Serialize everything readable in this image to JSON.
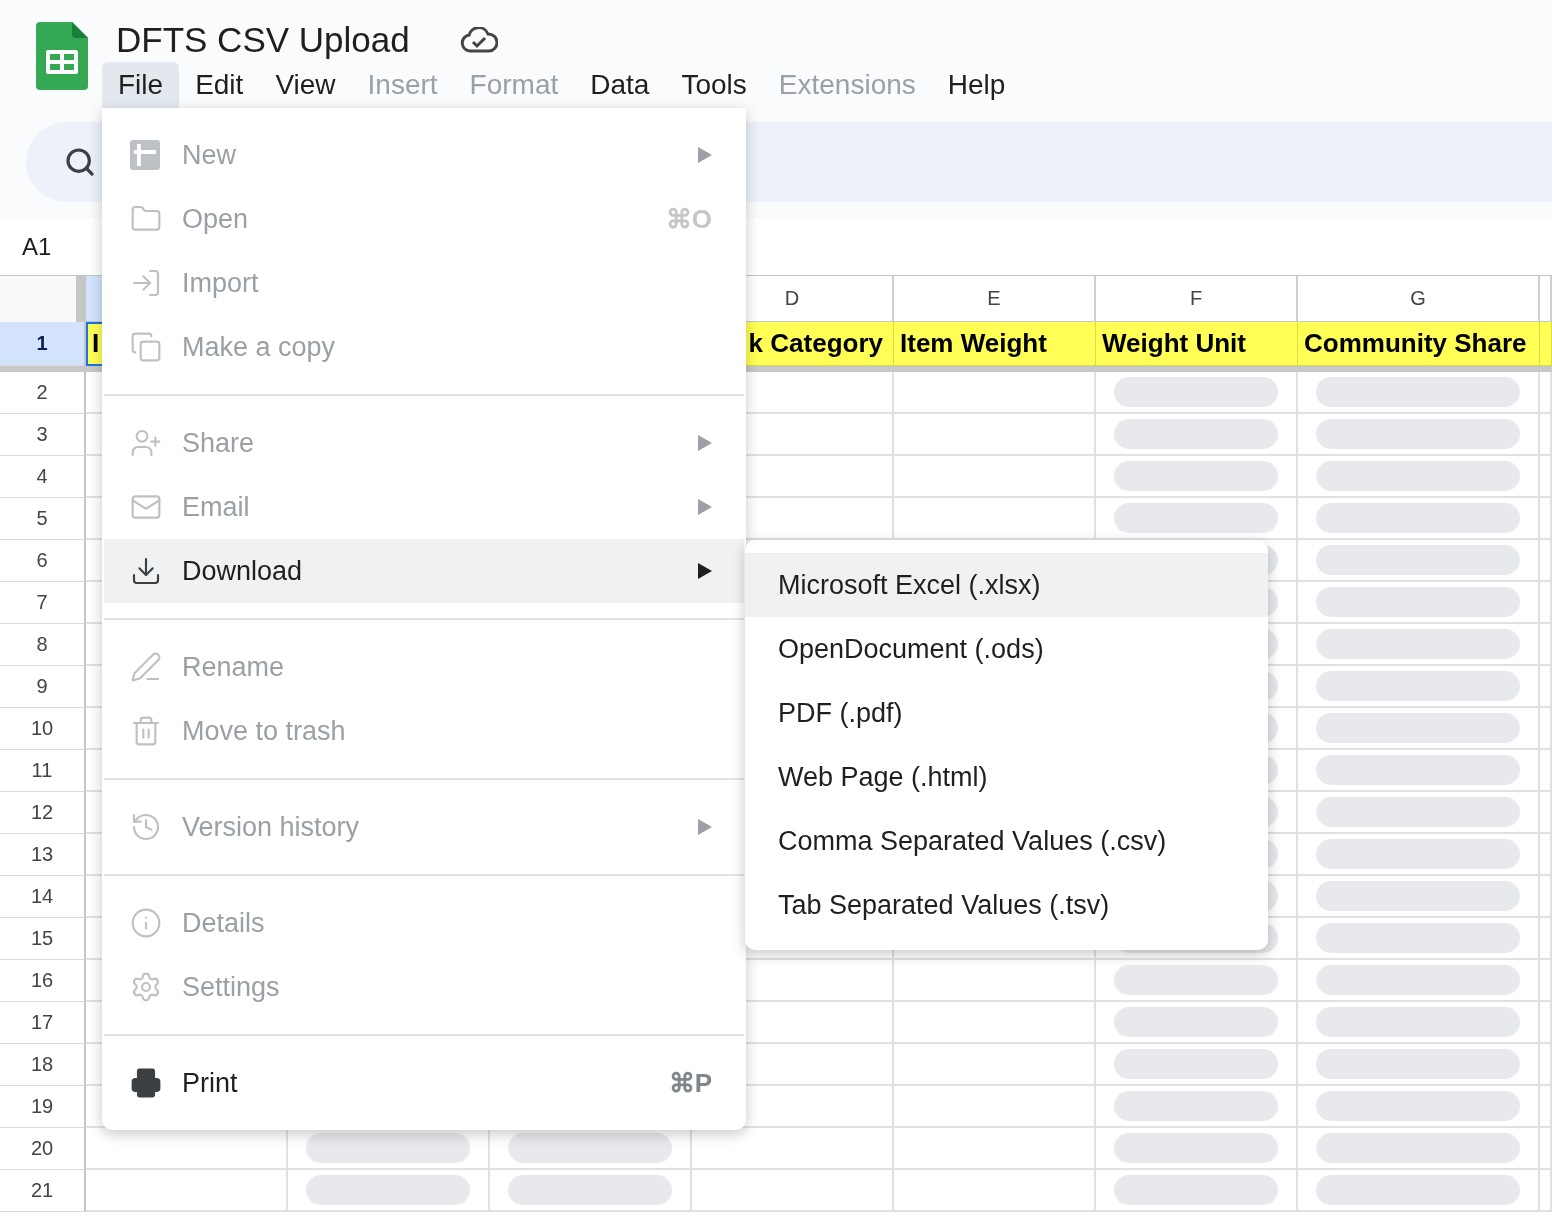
{
  "app": {
    "title": "DFTS CSV Upload"
  },
  "menubar": [
    {
      "label": "File",
      "selected": true,
      "disabled": false
    },
    {
      "label": "Edit",
      "selected": false,
      "disabled": false
    },
    {
      "label": "View",
      "selected": false,
      "disabled": false
    },
    {
      "label": "Insert",
      "selected": false,
      "disabled": true
    },
    {
      "label": "Format",
      "selected": false,
      "disabled": true
    },
    {
      "label": "Data",
      "selected": false,
      "disabled": false
    },
    {
      "label": "Tools",
      "selected": false,
      "disabled": false
    },
    {
      "label": "Extensions",
      "selected": false,
      "disabled": true
    },
    {
      "label": "Help",
      "selected": false,
      "disabled": false
    }
  ],
  "name_box": {
    "value": "A1"
  },
  "grid": {
    "columns": [
      {
        "selected": true,
        "kind": "text",
        "header_cell": {
          "text": "I",
          "selected": true
        }
      },
      {
        "kind": "dropdown"
      },
      {
        "kind": "dropdown"
      },
      {
        "letter": "D",
        "selected": false,
        "kind": "text",
        "header_cell": {
          "text": "k Category",
          "selected": false
        }
      },
      {
        "letter": "E",
        "selected": false,
        "kind": "text",
        "header_cell": {
          "text": "Item Weight",
          "selected": false
        }
      },
      {
        "letter": "F",
        "selected": false,
        "kind": "dropdown",
        "header_cell": {
          "text": "Weight Unit",
          "selected": false
        }
      },
      {
        "letter": "G",
        "selected": false,
        "kind": "dropdown",
        "header_cell": {
          "text": "Community Share",
          "selected": false
        }
      },
      {
        "selected": false,
        "kind": "text",
        "header_cell": {
          "selected": false
        }
      }
    ],
    "header_row": {
      "number": "1",
      "selected": true
    },
    "rows": [
      "2",
      "3",
      "4",
      "5",
      "6",
      "7",
      "8",
      "9",
      "10",
      "11",
      "12",
      "13",
      "14",
      "15",
      "16",
      "17",
      "18",
      "19",
      "20",
      "21"
    ]
  },
  "file_menu": {
    "sections": [
      [
        {
          "kind": "new",
          "label": "New",
          "disabled": true,
          "submenu": true,
          "highlighted": false
        },
        {
          "kind": "open",
          "label": "Open",
          "shortcut": "⌘O",
          "disabled": true,
          "submenu": false,
          "highlighted": false
        },
        {
          "kind": "import",
          "label": "Import",
          "disabled": true,
          "submenu": false,
          "highlighted": false
        },
        {
          "kind": "copy",
          "label": "Make a copy",
          "disabled": true,
          "submenu": false,
          "highlighted": false
        }
      ],
      [
        {
          "kind": "share",
          "label": "Share",
          "disabled": true,
          "submenu": true,
          "highlighted": false
        },
        {
          "kind": "email",
          "label": "Email",
          "disabled": true,
          "submenu": true,
          "highlighted": false
        },
        {
          "kind": "download",
          "label": "Download",
          "disabled": false,
          "submenu": true,
          "highlighted": true
        }
      ],
      [
        {
          "kind": "rename",
          "label": "Rename",
          "disabled": true,
          "submenu": false,
          "highlighted": false
        },
        {
          "kind": "trash",
          "label": "Move to trash",
          "disabled": true,
          "submenu": false,
          "highlighted": false
        }
      ],
      [
        {
          "kind": "history",
          "label": "Version history",
          "disabled": true,
          "submenu": true,
          "highlighted": false
        }
      ],
      [
        {
          "kind": "details",
          "label": "Details",
          "disabled": true,
          "submenu": false,
          "highlighted": false
        },
        {
          "kind": "settings",
          "label": "Settings",
          "disabled": true,
          "submenu": false,
          "highlighted": false
        }
      ],
      [
        {
          "kind": "print",
          "label": "Print",
          "shortcut": "⌘P",
          "disabled": false,
          "submenu": false,
          "highlighted": false
        }
      ]
    ]
  },
  "download_menu": {
    "items": [
      {
        "label": "Microsoft Excel (.xlsx)",
        "highlighted": true
      },
      {
        "label": "OpenDocument (.ods)",
        "highlighted": false
      },
      {
        "label": "PDF (.pdf)",
        "highlighted": false
      },
      {
        "label": "Web Page (.html)",
        "highlighted": false
      },
      {
        "label": "Comma Separated Values (.csv)",
        "highlighted": false
      },
      {
        "label": "Tab Separated Values (.tsv)",
        "highlighted": false
      }
    ]
  }
}
